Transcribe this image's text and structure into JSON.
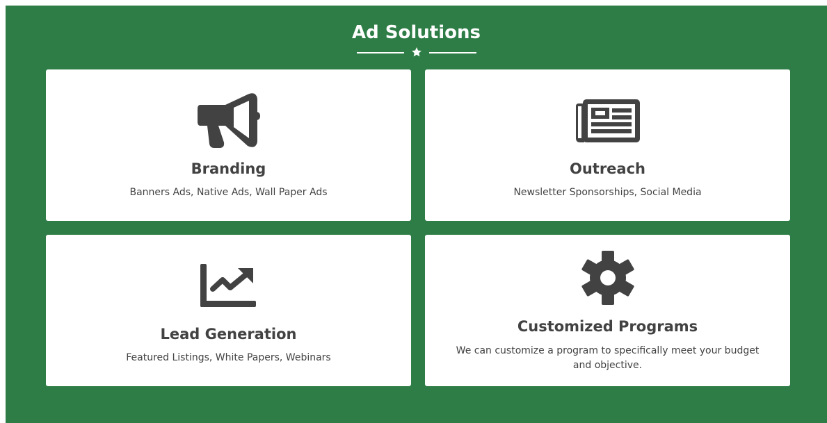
{
  "section": {
    "title": "Ad Solutions",
    "background_color": "#2e7d46",
    "divider_icon": "star-icon"
  },
  "cards": [
    {
      "title": "Branding",
      "description": "Banners Ads, Native Ads, Wall Paper Ads",
      "icon": "megaphone-icon"
    },
    {
      "title": "Outreach",
      "description": "Newsletter Sponsorships, Social Media",
      "icon": "newspaper-icon"
    },
    {
      "title": "Lead Generation",
      "description": "Featured Listings, White Papers, Webinars",
      "icon": "line-chart-icon"
    },
    {
      "title": "Customized Programs",
      "description": "We can customize a program to specifically meet your budget and objective.",
      "icon": "gear-icon"
    }
  ],
  "colors": {
    "card_background": "#ffffff",
    "text": "#424242",
    "icon": "#424242"
  }
}
